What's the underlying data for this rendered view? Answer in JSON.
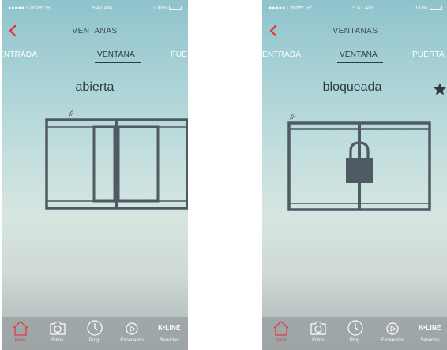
{
  "status_bar": {
    "carrier": "●●●●● Carrier",
    "time": "9:41 AM",
    "battery": "100%"
  },
  "nav": {
    "title": "VENTANAS"
  },
  "tabs": [
    "ENTRADA",
    "VENTANA",
    "PUERTA DE"
  ],
  "tabs_screen2": [
    "ENTRADA",
    "VENTANA",
    "PUERTA"
  ],
  "screens": [
    {
      "state": "abierta",
      "window_type": "sliding-open"
    },
    {
      "state": "bloqueada",
      "window_type": "locked"
    }
  ],
  "tab_bar": {
    "items": [
      {
        "label": "Inicio",
        "icon": "home-icon",
        "active": true
      },
      {
        "label": "Fotos",
        "icon": "camera-icon"
      },
      {
        "label": "Prog.",
        "icon": "clock-icon"
      },
      {
        "label": "Escenarios",
        "icon": "play-icon"
      },
      {
        "label": "Servicios",
        "icon": "kline-logo"
      }
    ],
    "logo_text": "K•LINE"
  },
  "colors": {
    "accent_red": "#e03a3e",
    "frame_gray": "#4f5a62",
    "text_dark": "#2d3a42",
    "tab_bar": "#9ba2a5"
  }
}
